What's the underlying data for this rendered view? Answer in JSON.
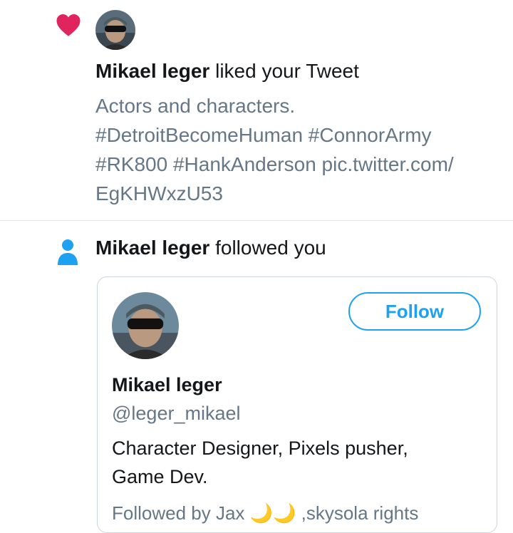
{
  "like_notification": {
    "icon": "heart-icon",
    "icon_color": "#e0245e",
    "user_name": "Mikael leger",
    "action_text": " liked your Tweet",
    "tweet_lines": [
      "Actors and characters.",
      "#DetroitBecomeHuman #ConnorArmy",
      "#RK800 #HankAnderson pic.twitter.com/",
      "EgKHWxzU53"
    ]
  },
  "follow_notification": {
    "icon": "person-icon",
    "icon_color": "#1da1f2",
    "user_name": "Mikael leger",
    "action_text": " followed you",
    "card": {
      "follow_button_label": "Follow",
      "profile_name": "Mikael leger",
      "profile_handle": "@leger_mikael",
      "bio_lines": [
        "Character Designer,  Pixels pusher,",
        "Game Dev."
      ],
      "followed_by_text": "Followed by Jax 🌙🌙 ,skysola rights"
    }
  },
  "colors": {
    "accent": "#1da1f2",
    "secondary_text": "#657786",
    "divider": "#e1e8ed"
  }
}
